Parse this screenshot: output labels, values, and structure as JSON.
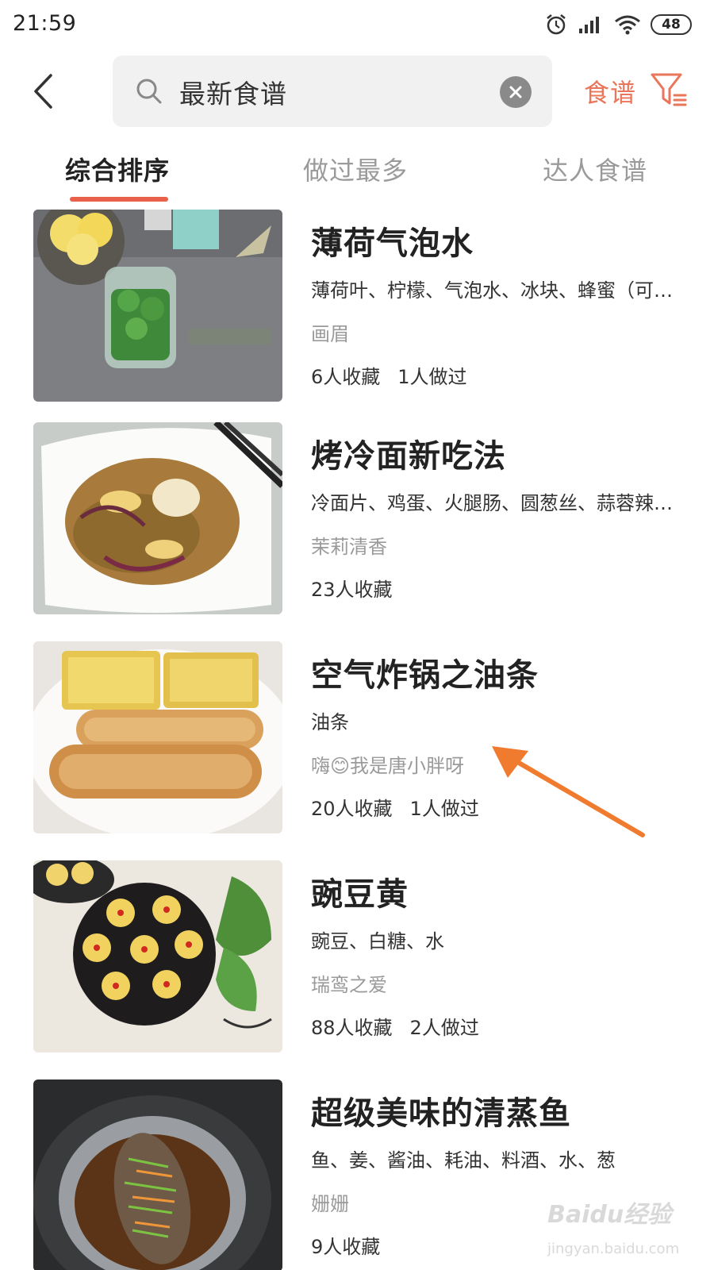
{
  "status_bar": {
    "time": "21:59",
    "battery": "48",
    "icons": [
      "alarm-icon",
      "signal-icon",
      "wifi-icon",
      "battery-icon"
    ]
  },
  "header": {
    "search_query": "最新食谱",
    "filter_label": "食谱",
    "accent_color": "#e9765a"
  },
  "tabs": [
    {
      "label": "综合排序",
      "active": true
    },
    {
      "label": "做过最多",
      "active": false
    },
    {
      "label": "达人食谱",
      "active": false
    }
  ],
  "recipes": [
    {
      "title": "薄荷气泡水",
      "ingredients": "薄荷叶、柠檬、气泡水、冰块、蜂蜜（可…",
      "author": "画眉",
      "favorites": "6人收藏",
      "made": "1人做过"
    },
    {
      "title": "烤冷面新吃法",
      "ingredients": "冷面片、鸡蛋、火腿肠、圆葱丝、蒜蓉辣…",
      "author": "茉莉清香",
      "favorites": "23人收藏",
      "made": ""
    },
    {
      "title": "空气炸锅之油条",
      "ingredients": "油条",
      "author": "嗨😊我是唐小胖呀",
      "favorites": "20人收藏",
      "made": "1人做过"
    },
    {
      "title": "豌豆黄",
      "ingredients": "豌豆、白糖、水",
      "author": "瑞鸾之爱",
      "favorites": "88人收藏",
      "made": "2人做过"
    },
    {
      "title": "超级美味的清蒸鱼",
      "ingredients": "鱼、姜、酱油、耗油、料酒、水、葱",
      "author": "姗姗",
      "favorites": "9人收藏",
      "made": ""
    }
  ],
  "watermark": {
    "brand": "Baidu经验",
    "url": "jingyan.baidu.com"
  }
}
